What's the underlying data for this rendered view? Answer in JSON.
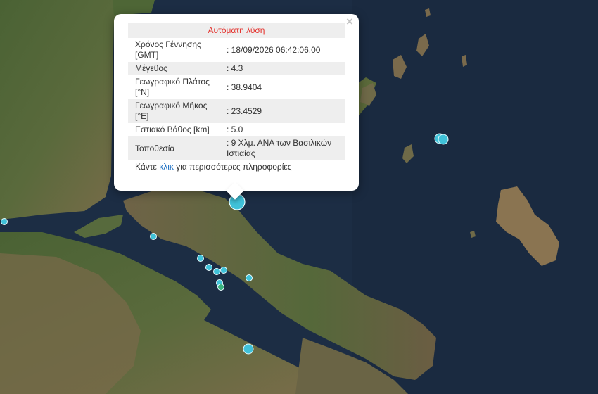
{
  "popup": {
    "title": "Αυτόματη λύση",
    "close_symbol": "×",
    "rows": [
      {
        "label": "Χρόνος Γέννησης [GMT]",
        "value": ": 18/09/2026 06:42:06.00"
      },
      {
        "label": "Μέγεθος",
        "value": ": 4.3"
      },
      {
        "label": "Γεωγραφικό Πλάτος [°N]",
        "value": ": 38.9404"
      },
      {
        "label": "Γεωγραφικό Μήκος [°E]",
        "value": ": 23.4529"
      },
      {
        "label": "Εστιακό Βάθος [km]",
        "value": ": 5.0"
      },
      {
        "label": "Τοποθεσία",
        "value": ": 9 Χλμ. ΑΝΑ των Βασιλικών Ιστιαίας"
      }
    ],
    "more_prefix": "Κάντε ",
    "more_link": "κλικ",
    "more_suffix": " για περισσότερες πληροφορίες"
  },
  "colors": {
    "sea": "#1c2d44",
    "land_green": "#3d5a2b",
    "land_brown": "#7a6a4c",
    "marker_fill": "#40c2d9",
    "marker_stroke": "#ffffff",
    "title_red": "#e4342f",
    "link_blue": "#1b6ec2"
  }
}
